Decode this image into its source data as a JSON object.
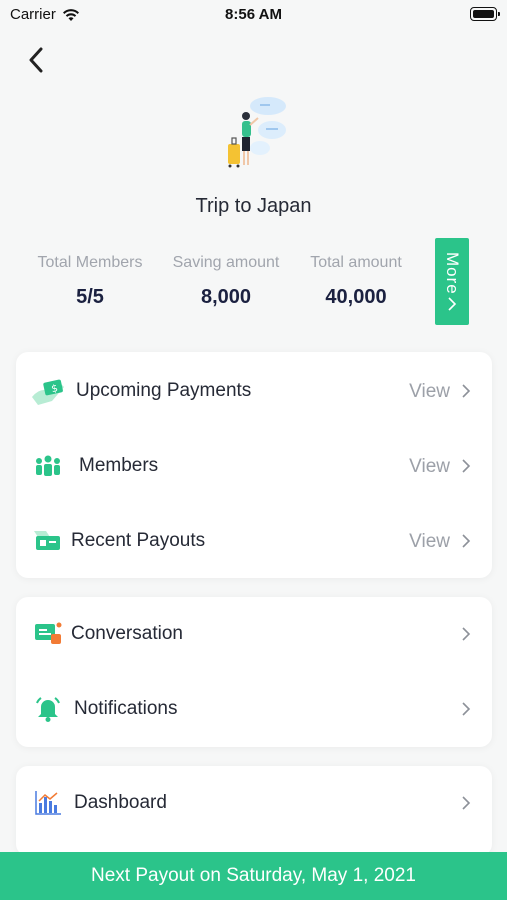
{
  "status_bar": {
    "carrier": "Carrier",
    "time": "8:56 AM"
  },
  "trip": {
    "title": "Trip to Japan",
    "hero_icon": "traveler-illustration"
  },
  "stats": [
    {
      "label": "Total Members",
      "value": "5/5"
    },
    {
      "label": "Saving amount",
      "value": "8,000"
    },
    {
      "label": "Total amount",
      "value": "40,000"
    }
  ],
  "more_button": {
    "label": "More",
    "icon": "chevron-right-icon"
  },
  "menu": {
    "payments": [
      {
        "label": "Upcoming Payments",
        "action": "View",
        "icon": "money-hand-icon"
      },
      {
        "label": "Members",
        "action": "View",
        "icon": "group-icon"
      },
      {
        "label": "Recent Payouts",
        "action": "View",
        "icon": "payout-card-icon"
      }
    ],
    "social": [
      {
        "label": "Conversation",
        "icon": "chat-icon"
      },
      {
        "label": "Notifications",
        "icon": "bell-icon"
      }
    ],
    "insights": [
      {
        "label": "Dashboard",
        "icon": "bar-chart-icon"
      }
    ]
  },
  "footer": {
    "text": "Next Payout on Saturday, May 1, 2021"
  },
  "colors": {
    "accent": "#2bc48a",
    "text": "#262a36",
    "muted": "#9ca0a8"
  }
}
